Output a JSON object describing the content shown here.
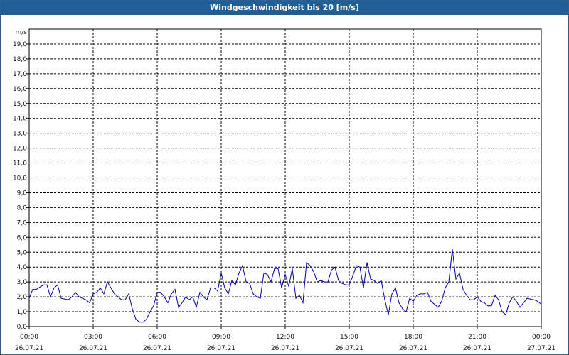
{
  "window": {
    "title": "Windgeschwindigkeit bis 20 [m/s]"
  },
  "chart_data": {
    "type": "line",
    "title": "Windgeschwindigkeit bis 20 [m/s]",
    "ylabel": "m/s",
    "ylim": [
      0,
      20
    ],
    "yticks": [
      "0,0",
      "1,0",
      "2,0",
      "3,0",
      "4,0",
      "5,0",
      "6,0",
      "7,0",
      "8,0",
      "9,0",
      "10,0",
      "11,0",
      "12,0",
      "13,0",
      "14,0",
      "15,0",
      "16,0",
      "17,0",
      "18,0",
      "19,0"
    ],
    "xlim": [
      "26.07.21 00:00",
      "27.07.21 00:00"
    ],
    "xticks": [
      {
        "time": "00:00",
        "date": "26.07.21"
      },
      {
        "time": "03:00",
        "date": "26.07.21"
      },
      {
        "time": "06:00",
        "date": "26.07.21"
      },
      {
        "time": "09:00",
        "date": "26.07.21"
      },
      {
        "time": "12:00",
        "date": "26.07.21"
      },
      {
        "time": "15:00",
        "date": "26.07.21"
      },
      {
        "time": "18:00",
        "date": "26.07.21"
      },
      {
        "time": "21:00",
        "date": "26.07.21"
      },
      {
        "time": "00:00",
        "date": "27.07.21"
      }
    ],
    "grid": true,
    "series": [
      {
        "color": "#0000a0",
        "x": [
          "00:00",
          "00:10",
          "00:20",
          "00:40",
          "00:50",
          "01:00",
          "01:10",
          "01:20",
          "01:30",
          "01:50",
          "02:00",
          "02:10",
          "02:20",
          "02:40",
          "02:50",
          "03:00",
          "03:10",
          "03:20",
          "03:30",
          "03:40",
          "04:00",
          "04:10",
          "04:20",
          "04:30",
          "04:40",
          "04:50",
          "05:00",
          "05:10",
          "05:20",
          "05:30",
          "05:40",
          "05:50",
          "06:00",
          "06:10",
          "06:20",
          "06:30",
          "06:40",
          "06:50",
          "07:00",
          "07:10",
          "07:20",
          "07:30",
          "07:40",
          "07:50",
          "08:00",
          "08:10",
          "08:20",
          "08:30",
          "08:40",
          "08:50",
          "09:00",
          "09:10",
          "09:20",
          "09:30",
          "09:40",
          "09:50",
          "10:00",
          "10:10",
          "10:20",
          "10:30",
          "10:40",
          "10:50",
          "11:00",
          "11:10",
          "11:20",
          "11:30",
          "11:40",
          "11:50",
          "12:00",
          "12:10",
          "12:20",
          "12:30",
          "12:40",
          "12:50",
          "13:00",
          "13:10",
          "13:20",
          "13:30",
          "13:40",
          "13:50",
          "14:00",
          "14:10",
          "14:20",
          "14:30",
          "14:40",
          "14:50",
          "15:00",
          "15:10",
          "15:20",
          "15:30",
          "15:40",
          "15:50",
          "16:00",
          "16:10",
          "16:20",
          "16:30",
          "16:40",
          "16:50",
          "17:00",
          "17:10",
          "17:20",
          "17:30",
          "17:40",
          "17:50",
          "18:00",
          "18:10",
          "18:20",
          "18:30",
          "18:40",
          "18:50",
          "19:00",
          "19:10",
          "19:20",
          "19:30",
          "19:40",
          "19:50",
          "20:00",
          "20:10",
          "20:20",
          "20:30",
          "20:40",
          "20:50",
          "21:00",
          "21:10",
          "21:20",
          "21:30",
          "21:40",
          "21:50",
          "22:00",
          "22:10",
          "22:20",
          "22:30",
          "22:40",
          "22:50",
          "23:00",
          "23:20",
          "23:40",
          "23:50",
          "24:00"
        ],
        "y": [
          1.9,
          2.5,
          2.5,
          2.8,
          2.8,
          2.0,
          2.6,
          2.8,
          1.9,
          1.8,
          2.0,
          2.3,
          2.0,
          1.8,
          1.6,
          2.2,
          2.3,
          2.6,
          2.2,
          3.0,
          2.2,
          2.0,
          1.8,
          1.8,
          2.2,
          1.2,
          0.5,
          0.3,
          0.3,
          0.5,
          1.0,
          1.4,
          2.3,
          2.3,
          2.0,
          1.6,
          2.2,
          2.5,
          1.3,
          1.6,
          2.0,
          1.8,
          2.0,
          1.3,
          2.3,
          2.0,
          1.8,
          2.6,
          2.6,
          2.4,
          3.6,
          2.6,
          2.2,
          3.1,
          2.8,
          3.6,
          4.1,
          3.0,
          2.9,
          2.2,
          2.0,
          1.9,
          3.6,
          3.5,
          3.0,
          3.9,
          3.9,
          2.6,
          3.5,
          2.7,
          3.9,
          1.9,
          2.1,
          1.6,
          4.3,
          4.1,
          3.7,
          3.0,
          3.1,
          3.0,
          3.0,
          3.8,
          4.0,
          3.1,
          2.9,
          2.8,
          2.8,
          3.4,
          4.1,
          4.0,
          2.6,
          4.3,
          3.2,
          3.1,
          2.9,
          3.1,
          1.8,
          0.8,
          2.2,
          2.6,
          1.6,
          1.2,
          1.0,
          1.9,
          1.7,
          2.1,
          2.2,
          2.2,
          2.3,
          1.7,
          1.5,
          1.3,
          1.7,
          2.6,
          3.0,
          5.2,
          3.2,
          3.6,
          2.5,
          2.1,
          1.8,
          1.8,
          2.0,
          1.7,
          1.6,
          1.4,
          1.4,
          2.1,
          1.8,
          1.0,
          0.8,
          1.6,
          2.0,
          1.7,
          1.3,
          1.9,
          1.8,
          1.7,
          1.5
        ]
      }
    ]
  }
}
